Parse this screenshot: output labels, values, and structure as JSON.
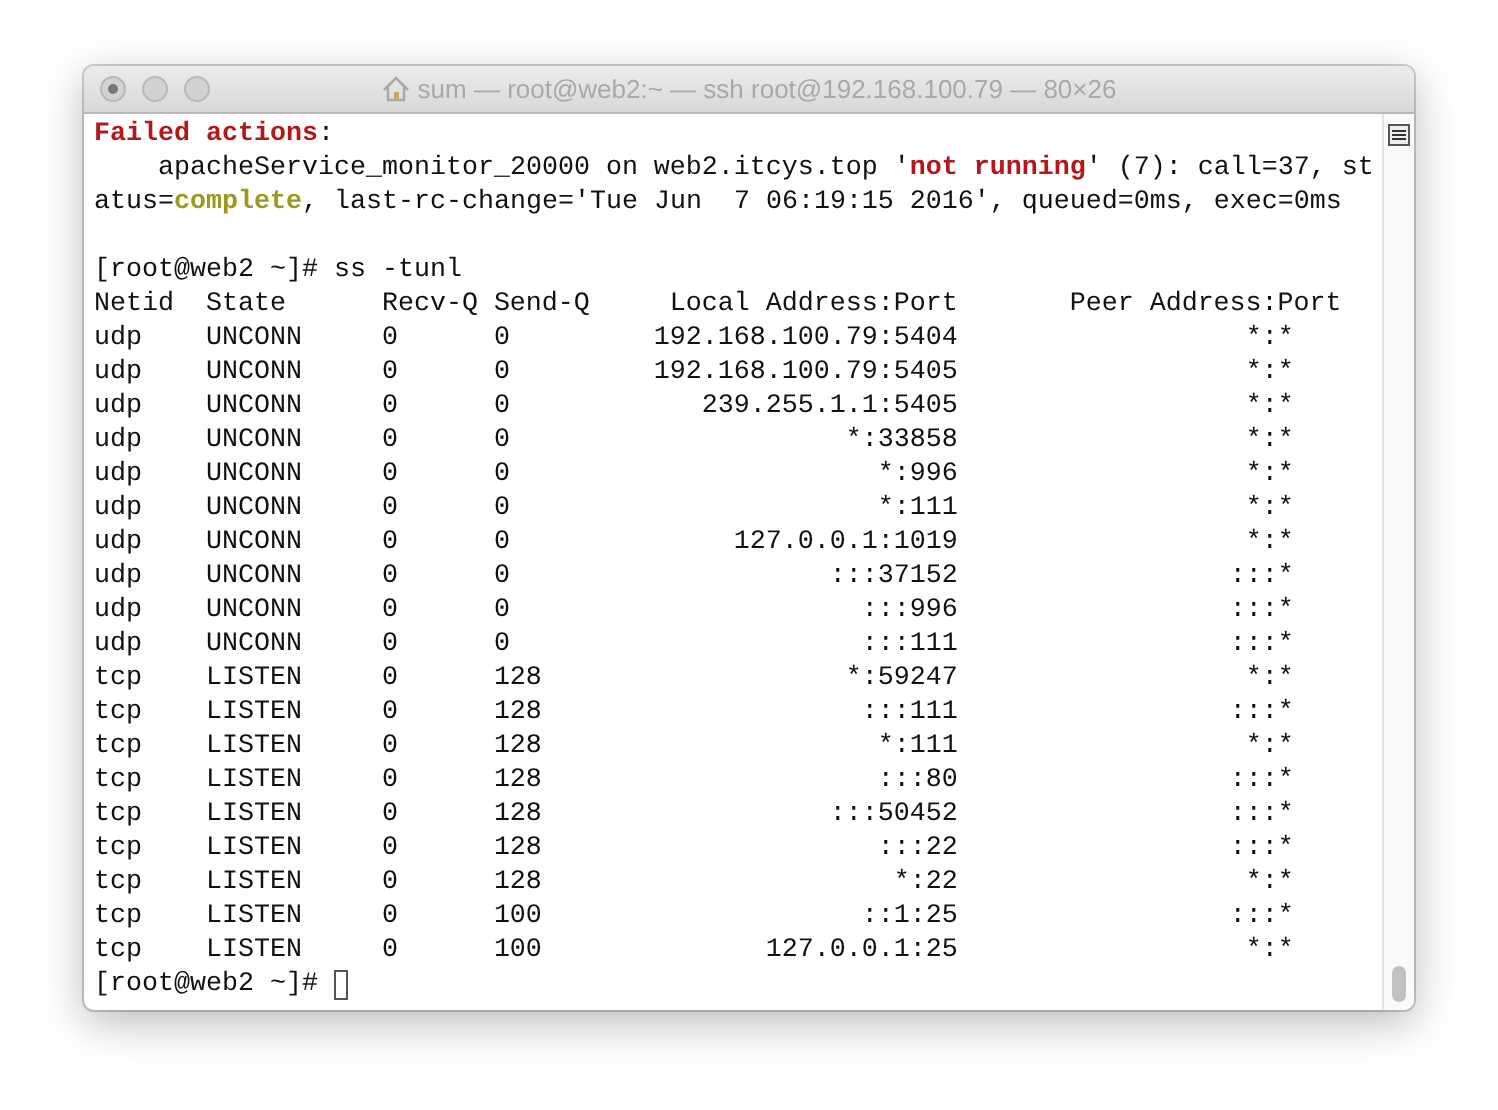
{
  "window": {
    "title": "sum — root@web2:~ — ssh root@192.168.100.79 — 80×26"
  },
  "lines": [
    {
      "segments": [
        {
          "text": "Failed actions",
          "kind": "error"
        },
        {
          "text": ":",
          "kind": "plain"
        }
      ]
    },
    {
      "segments": [
        {
          "text": "    apacheService_monitor_20000 on web2.itcys.top '",
          "kind": "plain"
        },
        {
          "text": "not running",
          "kind": "error"
        },
        {
          "text": "' (7): call=37, st",
          "kind": "plain"
        }
      ]
    },
    {
      "segments": [
        {
          "text": "atus=",
          "kind": "plain"
        },
        {
          "text": "complete",
          "kind": "success"
        },
        {
          "text": ", last-rc-change='Tue Jun  7 06:19:15 2016', queued=0ms, exec=0ms",
          "kind": "plain"
        }
      ]
    }
  ],
  "command_line": "[root@web2 ~]# ss -tunl",
  "table": {
    "columns": [
      "Netid",
      "State",
      "Recv-Q",
      "Send-Q",
      "Local Address:Port",
      "Peer Address:Port"
    ],
    "rows": [
      [
        "udp",
        "UNCONN",
        "0",
        "0",
        "192.168.100.79:5404",
        "*:*"
      ],
      [
        "udp",
        "UNCONN",
        "0",
        "0",
        "192.168.100.79:5405",
        "*:*"
      ],
      [
        "udp",
        "UNCONN",
        "0",
        "0",
        "239.255.1.1:5405",
        "*:*"
      ],
      [
        "udp",
        "UNCONN",
        "0",
        "0",
        "*:33858",
        "*:*"
      ],
      [
        "udp",
        "UNCONN",
        "0",
        "0",
        "*:996",
        "*:*"
      ],
      [
        "udp",
        "UNCONN",
        "0",
        "0",
        "*:111",
        "*:*"
      ],
      [
        "udp",
        "UNCONN",
        "0",
        "0",
        "127.0.0.1:1019",
        "*:*"
      ],
      [
        "udp",
        "UNCONN",
        "0",
        "0",
        ":::37152",
        ":::*"
      ],
      [
        "udp",
        "UNCONN",
        "0",
        "0",
        ":::996",
        ":::*"
      ],
      [
        "udp",
        "UNCONN",
        "0",
        "0",
        ":::111",
        ":::*"
      ],
      [
        "tcp",
        "LISTEN",
        "0",
        "128",
        "*:59247",
        "*:*"
      ],
      [
        "tcp",
        "LISTEN",
        "0",
        "128",
        ":::111",
        ":::*"
      ],
      [
        "tcp",
        "LISTEN",
        "0",
        "128",
        "*:111",
        "*:*"
      ],
      [
        "tcp",
        "LISTEN",
        "0",
        "128",
        ":::80",
        ":::*"
      ],
      [
        "tcp",
        "LISTEN",
        "0",
        "128",
        ":::50452",
        ":::*"
      ],
      [
        "tcp",
        "LISTEN",
        "0",
        "128",
        ":::22",
        ":::*"
      ],
      [
        "tcp",
        "LISTEN",
        "0",
        "128",
        "*:22",
        "*:*"
      ],
      [
        "tcp",
        "LISTEN",
        "0",
        "100",
        "::1:25",
        ":::*"
      ],
      [
        "tcp",
        "LISTEN",
        "0",
        "100",
        "127.0.0.1:25",
        "*:*"
      ]
    ]
  },
  "final_prompt": "[root@web2 ~]#"
}
